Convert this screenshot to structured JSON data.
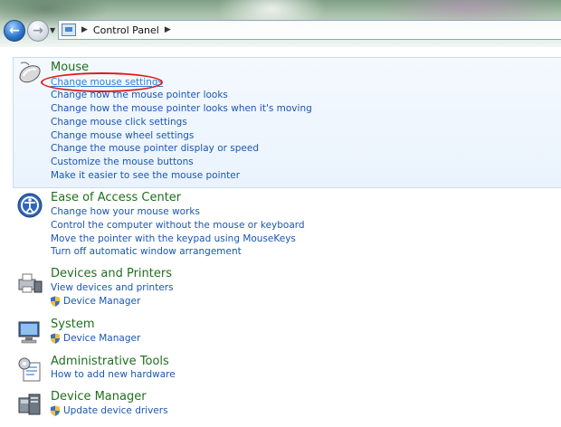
{
  "address": {
    "icon": "control-panel-icon",
    "path": [
      "Control Panel"
    ]
  },
  "categories": [
    {
      "title": "Mouse",
      "icon": "mouse-icon",
      "links": [
        "Change mouse settings",
        "Change how the mouse pointer looks",
        "Change how the mouse pointer looks when it's moving",
        "Change mouse click settings",
        "Change mouse wheel settings",
        "Change the mouse pointer display or speed",
        "Customize the mouse buttons",
        "Make it easier to see the mouse pointer"
      ]
    },
    {
      "title": "Ease of Access Center",
      "icon": "ease-of-access-icon",
      "links": [
        "Change how your mouse works",
        "Control the computer without the mouse or keyboard",
        "Move the pointer with the keypad using MouseKeys",
        "Turn off automatic window arrangement"
      ]
    },
    {
      "title": "Devices and Printers",
      "icon": "printer-icon",
      "links": [
        "View devices and printers",
        "Device Manager"
      ]
    },
    {
      "title": "System",
      "icon": "system-icon",
      "links": [
        "Device Manager"
      ]
    },
    {
      "title": "Administrative Tools",
      "icon": "admin-tools-icon",
      "links": [
        "How to add new hardware"
      ]
    },
    {
      "title": "Device Manager",
      "icon": "device-manager-icon",
      "links": [
        "Update device drivers"
      ]
    }
  ],
  "annotation": {
    "color": "#e01818"
  },
  "colors": {
    "category_title": "#1e6f1e",
    "link": "#1a56b0",
    "hover_link": "#2f7fd6",
    "highlight_bg": "#eaf3fd"
  }
}
